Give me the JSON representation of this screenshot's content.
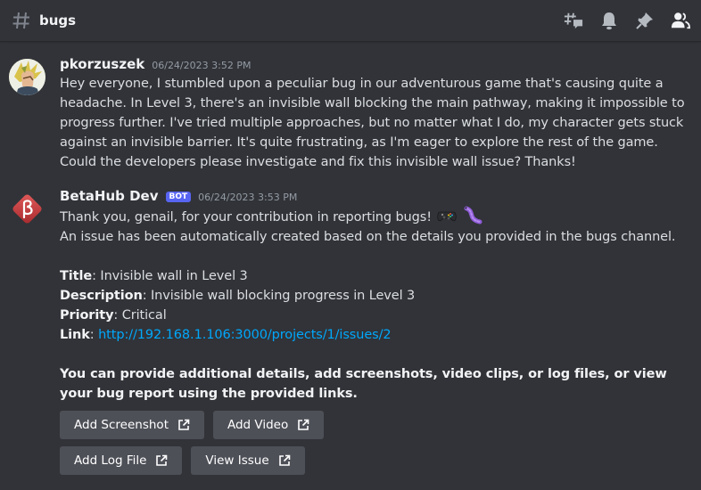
{
  "header": {
    "channel_icon": "hash-icon",
    "channel_name": "bugs",
    "tools": [
      {
        "name": "threads-icon"
      },
      {
        "name": "notification-bell-icon"
      },
      {
        "name": "pin-icon"
      },
      {
        "name": "member-list-icon"
      }
    ]
  },
  "colors": {
    "background": "#313338",
    "link": "#00a8fc",
    "bot_tag": "#5865f2",
    "button": "#4e5058",
    "bot_avatar": "#c43c3c"
  },
  "messages": [
    {
      "author": "pkorzuszek",
      "timestamp": "06/24/2023 3:52 PM",
      "avatar_icon": "user-avatar",
      "content": "Hey everyone, I stumbled upon a peculiar bug in our adventurous game that's causing quite a headache. In Level 3, there's an invisible wall blocking the main pathway, making it impossible to progress further. I've tried multiple approaches, but no matter what I do, my character gets stuck against an invisible barrier. It's quite frustrating, as I'm eager to explore the rest of the game. Could the developers please investigate and fix this invisible wall issue? Thanks!"
    },
    {
      "author": "BetaHub Dev",
      "bot_tag": "BOT",
      "timestamp": "06/24/2023 3:53 PM",
      "avatar_icon": "betahub-logo",
      "thanks_line": "Thank you, genail, for your contribution in reporting bugs!",
      "emojis": [
        "gamepad-emoji",
        "worm-emoji"
      ],
      "created_line": "An issue has been automatically created based on the details you provided in the bugs channel.",
      "fields": [
        {
          "label": "Title",
          "value": "Invisible wall in Level 3"
        },
        {
          "label": "Description",
          "value": "Invisible wall blocking progress in Level 3"
        },
        {
          "label": "Priority",
          "value": "Critical"
        },
        {
          "label": "Link",
          "value": "http://192.168.1.106:3000/projects/1/issues/2"
        }
      ],
      "note": "You can provide additional details, add screenshots, video clips, or log files, or view your bug report using the provided links.",
      "buttons": [
        {
          "label": "Add Screenshot",
          "icon": "external-link-icon"
        },
        {
          "label": "Add Video",
          "icon": "external-link-icon"
        },
        {
          "label": "Add Log File",
          "icon": "external-link-icon"
        },
        {
          "label": "View Issue",
          "icon": "external-link-icon"
        }
      ]
    }
  ]
}
